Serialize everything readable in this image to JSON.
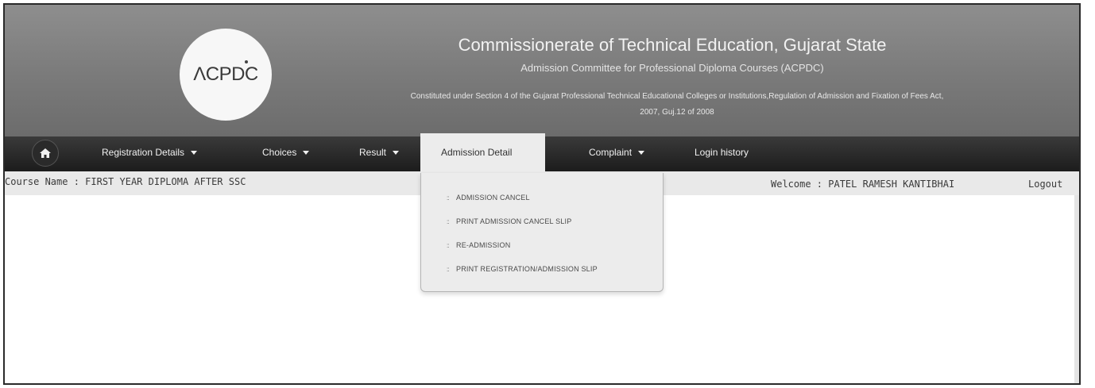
{
  "header": {
    "logo_text": "ΛCPDC",
    "title": "Commissionerate of Technical Education, Gujarat State",
    "subtitle": "Admission Committee for Professional Diploma Courses (ACPDC)",
    "act_line1": "Constituted under Section 4 of the Gujarat Professional Technical Educational Colleges or Institutions,Regulation of Admission and Fixation of Fees Act,",
    "act_line2": "2007, Guj.12 of 2008"
  },
  "nav": {
    "home_icon": "home-icon",
    "items": [
      {
        "label": "Registration Details",
        "has_caret": true
      },
      {
        "label": "Choices",
        "has_caret": true
      },
      {
        "label": "Result",
        "has_caret": true
      },
      {
        "label": "Admission Detail",
        "has_caret": true,
        "active": true
      },
      {
        "label": "Complaint",
        "has_caret": true
      },
      {
        "label": "Login history",
        "has_caret": false
      }
    ]
  },
  "info": {
    "course": "Course Name : FIRST YEAR DIPLOMA AFTER SSC",
    "welcome": "Welcome : PATEL RAMESH KANTIBHAI",
    "logout": "Logout"
  },
  "dropdown": {
    "items": [
      "ADMISSION CANCEL",
      "PRINT ADMISSION CANCEL SLIP",
      "RE-ADMISSION",
      "PRINT REGISTRATION/ADMISSION SLIP"
    ],
    "bullet": "::"
  },
  "colors": {
    "header_bg": "#7a7a7a",
    "navbar_bg": "#1c1c1c",
    "active_tab_bg": "#ececec",
    "infobar_bg": "#e9e9e9"
  }
}
